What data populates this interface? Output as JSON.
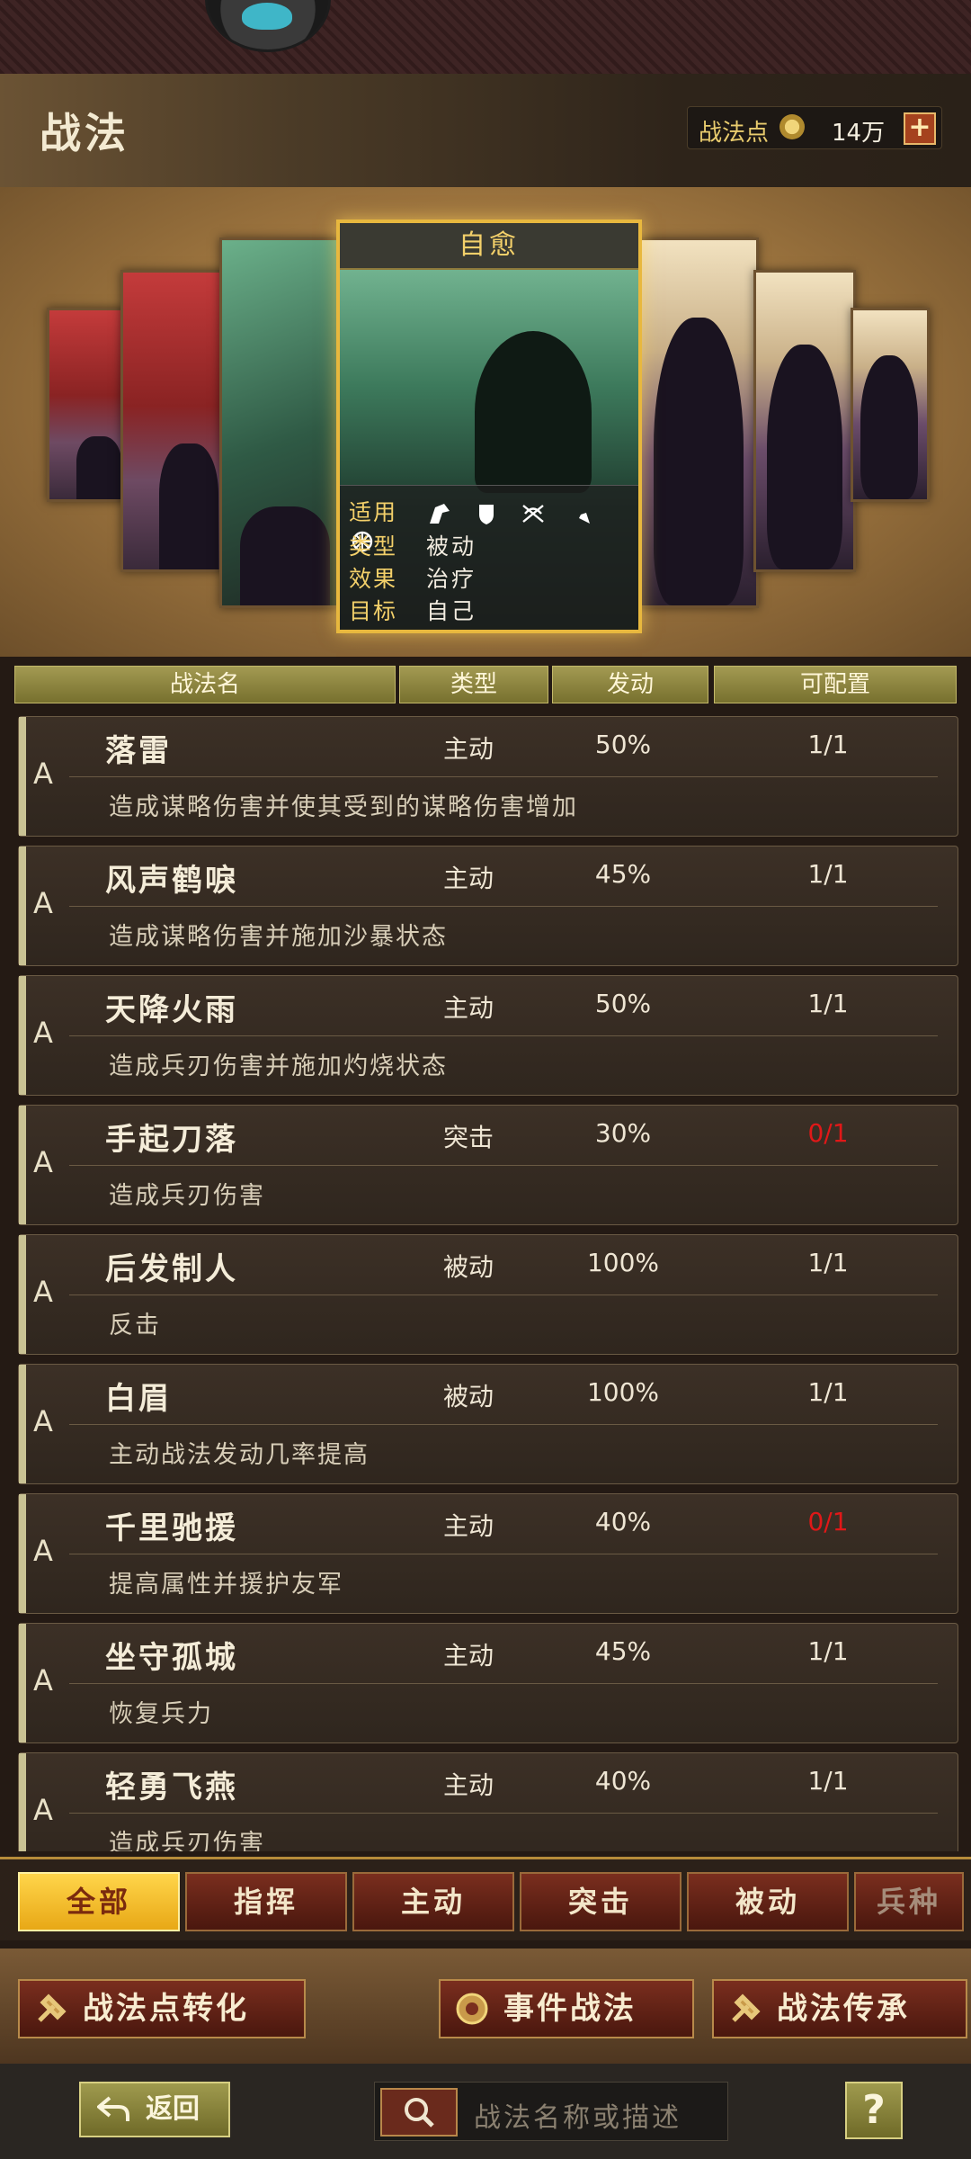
{
  "header": {
    "title": "战法",
    "points_label": "战法点",
    "points_value": "14万",
    "plus_label": "+"
  },
  "featured": {
    "title": "自愈",
    "rows": [
      {
        "key": "适用",
        "value": ""
      },
      {
        "key": "类型",
        "value": "被动"
      },
      {
        "key": "效果",
        "value": "治疗"
      },
      {
        "key": "目标",
        "value": "自己"
      }
    ],
    "troop_icons": [
      "cavalry-icon",
      "shield-icon",
      "archer-icon",
      "spear-icon",
      "siege-icon"
    ]
  },
  "table": {
    "headers": [
      "战法名",
      "类型",
      "发动",
      "可配置"
    ]
  },
  "skills": [
    {
      "grade": "A",
      "name": "落雷",
      "type": "主动",
      "rate": "50%",
      "slots": "1/1",
      "slots_red": false,
      "desc": "造成谋略伤害并使其受到的谋略伤害增加"
    },
    {
      "grade": "A",
      "name": "风声鹤唳",
      "type": "主动",
      "rate": "45%",
      "slots": "1/1",
      "slots_red": false,
      "desc": "造成谋略伤害并施加沙暴状态"
    },
    {
      "grade": "A",
      "name": "天降火雨",
      "type": "主动",
      "rate": "50%",
      "slots": "1/1",
      "slots_red": false,
      "desc": "造成兵刃伤害并施加灼烧状态"
    },
    {
      "grade": "A",
      "name": "手起刀落",
      "type": "突击",
      "rate": "30%",
      "slots": "0/1",
      "slots_red": true,
      "desc": "造成兵刃伤害"
    },
    {
      "grade": "A",
      "name": "后发制人",
      "type": "被动",
      "rate": "100%",
      "slots": "1/1",
      "slots_red": false,
      "desc": "反击"
    },
    {
      "grade": "A",
      "name": "白眉",
      "type": "被动",
      "rate": "100%",
      "slots": "1/1",
      "slots_red": false,
      "desc": "主动战法发动几率提高"
    },
    {
      "grade": "A",
      "name": "千里驰援",
      "type": "主动",
      "rate": "40%",
      "slots": "0/1",
      "slots_red": true,
      "desc": "提高属性并援护友军"
    },
    {
      "grade": "A",
      "name": "坐守孤城",
      "type": "主动",
      "rate": "45%",
      "slots": "1/1",
      "slots_red": false,
      "desc": "恢复兵力"
    },
    {
      "grade": "A",
      "name": "轻勇飞燕",
      "type": "主动",
      "rate": "40%",
      "slots": "1/1",
      "slots_red": false,
      "desc": "造成兵刃伤害"
    }
  ],
  "filter_tabs": [
    "全部",
    "指挥",
    "主动",
    "突击",
    "被动",
    "兵种"
  ],
  "actions": {
    "convert": "战法点转化",
    "event": "事件战法",
    "inherit": "战法传承"
  },
  "bottom": {
    "back": "返回",
    "search_placeholder": "战法名称或描述",
    "help": "?"
  }
}
